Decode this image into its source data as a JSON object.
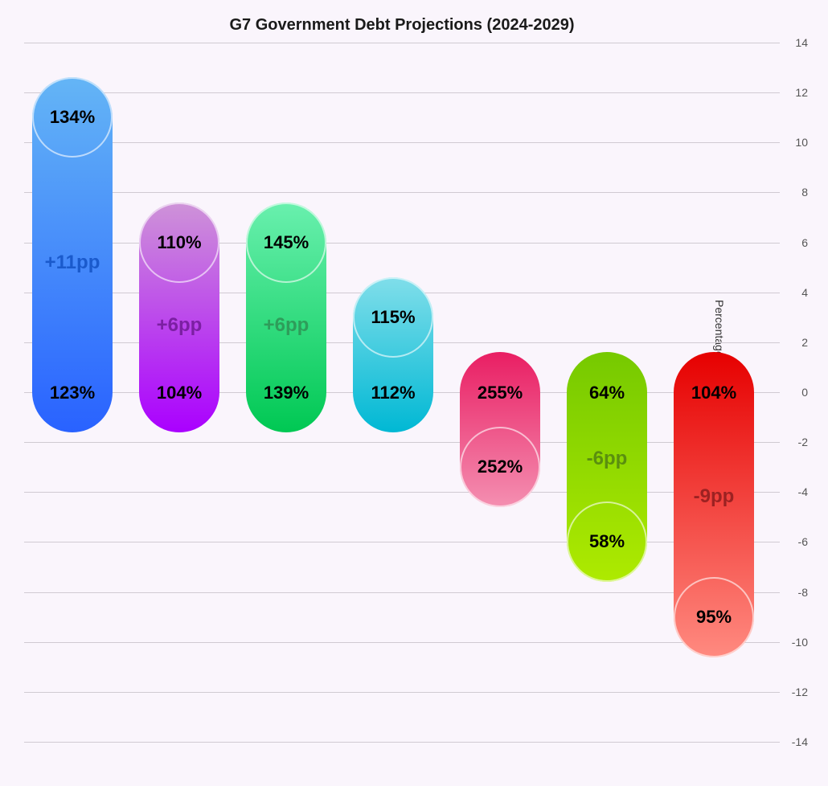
{
  "chart_data": {
    "type": "bar",
    "title": "G7 Government Debt Projections (2024-2029)",
    "ylabel": "Percentage Point Change 2024 to 2029",
    "ylim": [
      -14,
      14
    ],
    "y_ticks": [
      14,
      12,
      10,
      8,
      6,
      4,
      2,
      0,
      -2,
      -4,
      -6,
      -8,
      -10,
      -12,
      -14
    ],
    "series": [
      {
        "idx": 0,
        "debt_2024": 123,
        "debt_2029": 134,
        "change": 11,
        "change_label": "+11pp",
        "color_dark": "#2962ff",
        "color_light": "#64b5f6",
        "change_color": "#1a5acc"
      },
      {
        "idx": 1,
        "debt_2024": 104,
        "debt_2029": 110,
        "change": 6,
        "change_label": "+6pp",
        "color_dark": "#aa00ff",
        "color_light": "#ce93d8",
        "change_color": "#7b1fa2"
      },
      {
        "idx": 2,
        "debt_2024": 139,
        "debt_2029": 145,
        "change": 6,
        "change_label": "+6pp",
        "color_dark": "#00c853",
        "color_light": "#69f0ae",
        "change_color": "#2e9d5a"
      },
      {
        "idx": 3,
        "debt_2024": 112,
        "debt_2029": 115,
        "change": 3,
        "change_label": "",
        "color_dark": "#00b8d4",
        "color_light": "#80deea",
        "change_color": "#0097a7"
      },
      {
        "idx": 4,
        "debt_2024": 255,
        "debt_2029": 252,
        "change": -3,
        "change_label": "",
        "color_dark": "#e91e63",
        "color_light": "#f48fb1",
        "change_color": "#ad1457"
      },
      {
        "idx": 5,
        "debt_2024": 64,
        "debt_2029": 58,
        "change": -6,
        "change_label": "-6pp",
        "color_dark": "#76c900",
        "color_light": "#aeea00",
        "change_color": "#5a8f0f"
      },
      {
        "idx": 6,
        "debt_2024": 104,
        "debt_2029": 95,
        "change": -9,
        "change_label": "-9pp",
        "color_dark": "#e60000",
        "color_light": "#ff8a80",
        "change_color": "#9c2222"
      }
    ]
  }
}
